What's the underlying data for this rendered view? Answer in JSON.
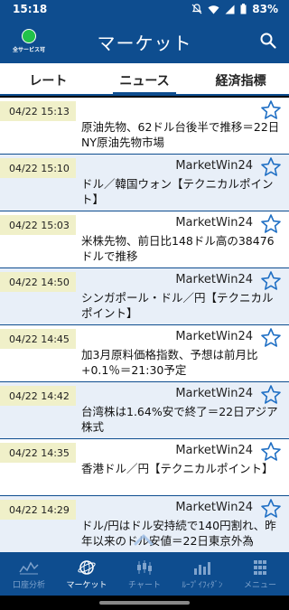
{
  "status_bar": {
    "time": "15:18",
    "battery": "83%"
  },
  "app_bar": {
    "status_label": "全サービス可",
    "title": "マーケット"
  },
  "tabs": [
    {
      "label": "レート"
    },
    {
      "label": "ニュース"
    },
    {
      "label": "経済指標"
    }
  ],
  "news": [
    {
      "date": "04/22 15:13",
      "source": "",
      "headline": "原油先物、62ドル台後半で推移＝22日NY原油先物市場"
    },
    {
      "date": "04/22 15:10",
      "source": "MarketWin24",
      "headline": "ドル／韓国ウォン【テクニカルポイント】"
    },
    {
      "date": "04/22 15:03",
      "source": "MarketWin24",
      "headline": "米株先物、前日比148ドル高の38476ドルで推移"
    },
    {
      "date": "04/22 14:50",
      "source": "MarketWin24",
      "headline": "シンガポール・ドル／円【テクニカルポイント】"
    },
    {
      "date": "04/22 14:45",
      "source": "MarketWin24",
      "headline": "加3月原料価格指数、予想は前月比+0.1％＝21:30予定"
    },
    {
      "date": "04/22 14:42",
      "source": "MarketWin24",
      "headline": "台湾株は1.64%安で終了＝22日アジア株式"
    },
    {
      "date": "04/22 14:35",
      "source": "MarketWin24",
      "headline": "香港ドル／円【テクニカルポイント】"
    },
    {
      "date": "04/22 14:29",
      "source": "MarketWin24",
      "headline": "ドル/円はドル安持続で140円割れ、昨年以来のドル安値＝22日東京外為"
    }
  ],
  "bottom_nav": [
    {
      "label": "口座分析",
      "icon": "chart-wave-icon"
    },
    {
      "label": "マーケット",
      "icon": "globe-icon"
    },
    {
      "label": "チャート",
      "icon": "candlestick-icon"
    },
    {
      "label": "ﾙｰﾌﾟｲﾌｨﾀﾞﾝ",
      "icon": "bar-chart-icon"
    },
    {
      "label": "メニュー",
      "icon": "grid-icon"
    }
  ],
  "colors": {
    "primary": "#0e4d8f",
    "date_bg": "#f0f0c9",
    "row_alt": "#e8eff8",
    "status_ok": "#21c24b"
  }
}
